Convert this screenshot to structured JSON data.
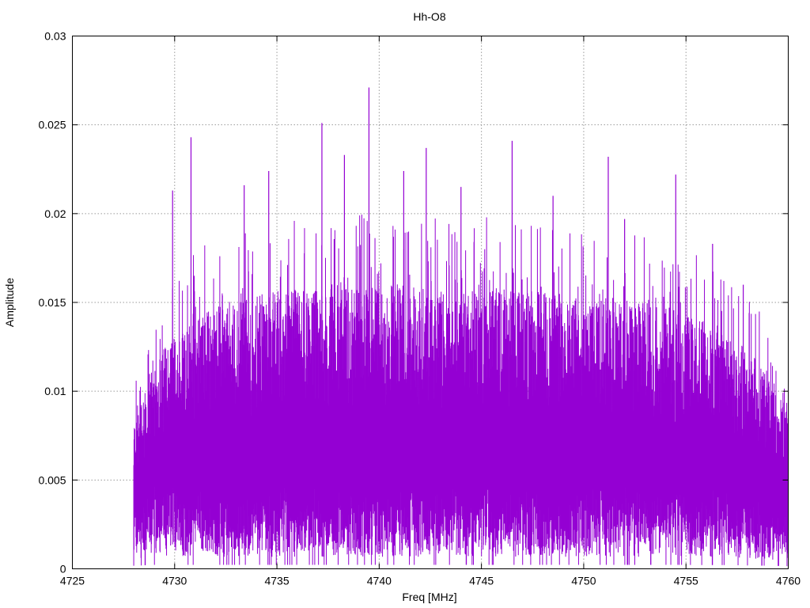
{
  "chart_data": {
    "type": "line",
    "title": "Hh-O8",
    "xlabel": "Freq [MHz]",
    "ylabel": "Amplitude",
    "xlim": [
      4725,
      4760
    ],
    "ylim": [
      0,
      0.03
    ],
    "x_ticks": [
      "4725",
      "4730",
      "4735",
      "4740",
      "4745",
      "4750",
      "4755",
      "4760"
    ],
    "y_ticks": [
      "0",
      "0.005",
      "0.01",
      "0.015",
      "0.02",
      "0.025",
      "0.03"
    ],
    "grid": true,
    "series": [
      {
        "color": "#9400d3",
        "x_start": 4728.0,
        "x_end": 4760.0,
        "profile": {
          "x": [
            4728.0,
            4729.0,
            4731.0,
            4734.0,
            4738.0,
            4742.0,
            4746.0,
            4750.0,
            4754.0,
            4757.0,
            4759.0,
            4760.0
          ],
          "upper": [
            0.0085,
            0.012,
            0.0145,
            0.0155,
            0.016,
            0.016,
            0.0158,
            0.0155,
            0.0148,
            0.0135,
            0.0112,
            0.0095
          ],
          "lower": [
            0.0035,
            0.0045,
            0.0045,
            0.0045,
            0.0045,
            0.0045,
            0.0045,
            0.0045,
            0.0045,
            0.0042,
            0.0035,
            0.003
          ]
        },
        "peaks": [
          {
            "x": 4729.9,
            "y": 0.0213
          },
          {
            "x": 4730.8,
            "y": 0.0243
          },
          {
            "x": 4733.4,
            "y": 0.0216
          },
          {
            "x": 4734.6,
            "y": 0.0224
          },
          {
            "x": 4737.2,
            "y": 0.0251
          },
          {
            "x": 4738.3,
            "y": 0.0233
          },
          {
            "x": 4739.5,
            "y": 0.0271
          },
          {
            "x": 4741.2,
            "y": 0.0224
          },
          {
            "x": 4742.3,
            "y": 0.0237
          },
          {
            "x": 4744.0,
            "y": 0.0215
          },
          {
            "x": 4746.5,
            "y": 0.0241
          },
          {
            "x": 4748.5,
            "y": 0.021
          },
          {
            "x": 4751.2,
            "y": 0.0232
          },
          {
            "x": 4752.0,
            "y": 0.0197
          },
          {
            "x": 4754.5,
            "y": 0.0222
          },
          {
            "x": 4756.3,
            "y": 0.0183
          },
          {
            "x": 4757.8,
            "y": 0.016
          }
        ]
      }
    ]
  }
}
